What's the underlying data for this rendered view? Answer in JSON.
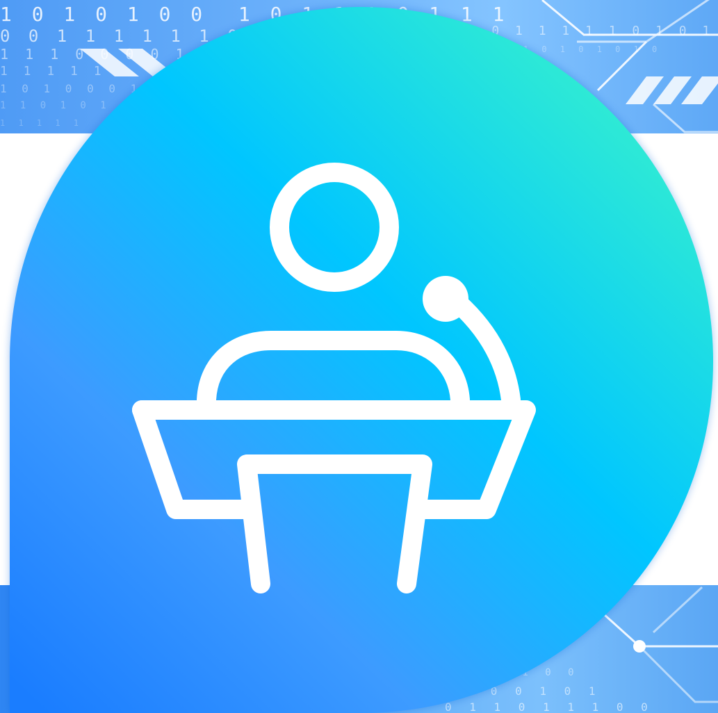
{
  "background": {
    "binary_rows_top": [
      "1 0 1 0 1 0 0  1 0 1 1 1 0 1 1 1",
      "0 0 1 1 1 1 1 1 0 0 0 1",
      "1 1 1 0 0 0 0 1 0",
      "1 1 1 1 1",
      "1 0 1 0 0 0 1",
      "1 1 0 1 0 1",
      "1 1 1 1 1"
    ],
    "binary_rows_top_right": [
      "0 1 0 1 1 1 1 1 0 1 0 1 0",
      "1 0 1 0 1 0 1 0 1 0"
    ],
    "binary_rows_bottom": [
      "0 0 0 0 1 0 0",
      "0 0 1 0 0 1 0 1",
      "0 1 1 0 1 1 1 0 0"
    ]
  },
  "icon": {
    "name": "speaker-podium-icon",
    "gradient_colors": [
      "#1a7dff",
      "#00c6ff",
      "#3df5c8"
    ],
    "stroke_color": "#ffffff"
  },
  "colors": {
    "band_top": "#6eb3fb",
    "band_bottom": "#58a7f7",
    "middle": "#ffffff"
  }
}
